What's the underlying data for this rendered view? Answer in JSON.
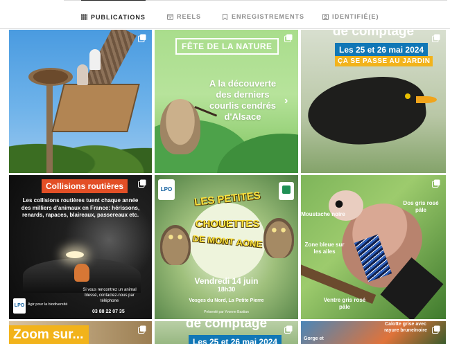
{
  "tabs": [
    {
      "label": "PUBLICATIONS",
      "icon": "grid-icon",
      "active": true
    },
    {
      "label": "REELS",
      "icon": "reels-icon",
      "active": false
    },
    {
      "label": "ENREGISTREMENTS",
      "icon": "bookmark-icon",
      "active": false
    },
    {
      "label": "IDENTIFIÉ(E)",
      "icon": "tagged-icon",
      "active": false
    }
  ],
  "posts": {
    "fete": {
      "tag": "FÊTE DE LA NATURE",
      "text": "A la découverte des derniers courlis cendrés d'Alsace"
    },
    "comptage": {
      "header": "de comptage",
      "date": "Les 25 et 26 mai 2024",
      "sub": "ÇA SE PASSE AU JARDIN"
    },
    "collisions": {
      "title": "Collisions routières",
      "text": "Les collisions routières tuent chaque année des milliers d'animaux en France: hérissons, renards, rapaces, blaireaux, passereaux etc.",
      "note": "Si vous rencontrez un animal blessé, contactez-nous par téléphone",
      "phone": "03 88 22 07 35",
      "logo": "LPO",
      "logo_tag": "Agir pour la biodiversité"
    },
    "chouettes": {
      "logo": "LPO",
      "w1": "LES PETITES",
      "w2": "CHOUETTES",
      "w3": "DE MONT AONE",
      "date": "Vendredi 14 juin",
      "hour": "18h30",
      "place": "Vosges du Nord, La Petite Pierre",
      "org": "Présenté par Yvonne Bastian"
    },
    "geai": {
      "top": "",
      "label_moustache": "Moustache noire",
      "label_dos": "Dos gris rosé pâle",
      "label_zone": "Zone bleue sur les ailes",
      "label_ventre": "Ventre gris rosé pâle"
    },
    "zoom": {
      "tag": "Zoom sur..."
    },
    "comptage2": {
      "header": "de comptage",
      "date": "Les 25 et 26 mai 2024"
    },
    "bird3": {
      "label": "Calotte grise avec rayure brune/noire",
      "label2": "Gorge et"
    }
  },
  "colors": {
    "accent_orange": "#e34f26",
    "lpo_blue": "#1177b6",
    "yellow": "#f2b31b"
  }
}
